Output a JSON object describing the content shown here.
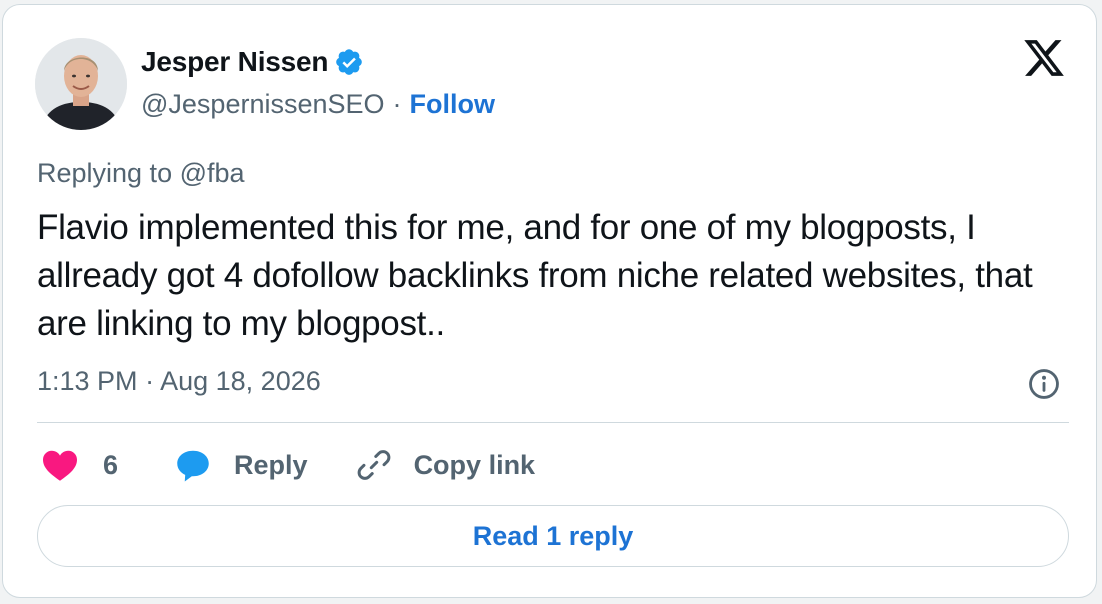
{
  "author": {
    "name": "Jesper Nissen",
    "handle": "@JespernissenSEO",
    "separator": "·",
    "follow_label": "Follow",
    "verified_color": "#1d9bf0"
  },
  "icons": {
    "avatar": "profile-photo",
    "verified": "verified-badge-icon",
    "brand": "x-logo-icon",
    "info": "info-icon",
    "like": "heart-icon",
    "reply": "speech-bubble-icon",
    "copy": "link-icon"
  },
  "tweet": {
    "replying_to": "Replying to @fba",
    "text": "Flavio implemented this for me, and for one of my blogposts, I allready got 4 dofollow backlinks from niche related websites, that are linking to my blogpost..",
    "time": "1:13 PM",
    "date": "Aug 18, 2026",
    "separator": "·"
  },
  "actions": {
    "like_count": "6",
    "reply_label": "Reply",
    "copy_label": "Copy link"
  },
  "read_replies_label": "Read 1 reply",
  "colors": {
    "accent": "#1d73d4",
    "like": "#f91880",
    "reply_icon": "#1d9bf0",
    "muted": "#536471",
    "text": "#0f1419"
  }
}
